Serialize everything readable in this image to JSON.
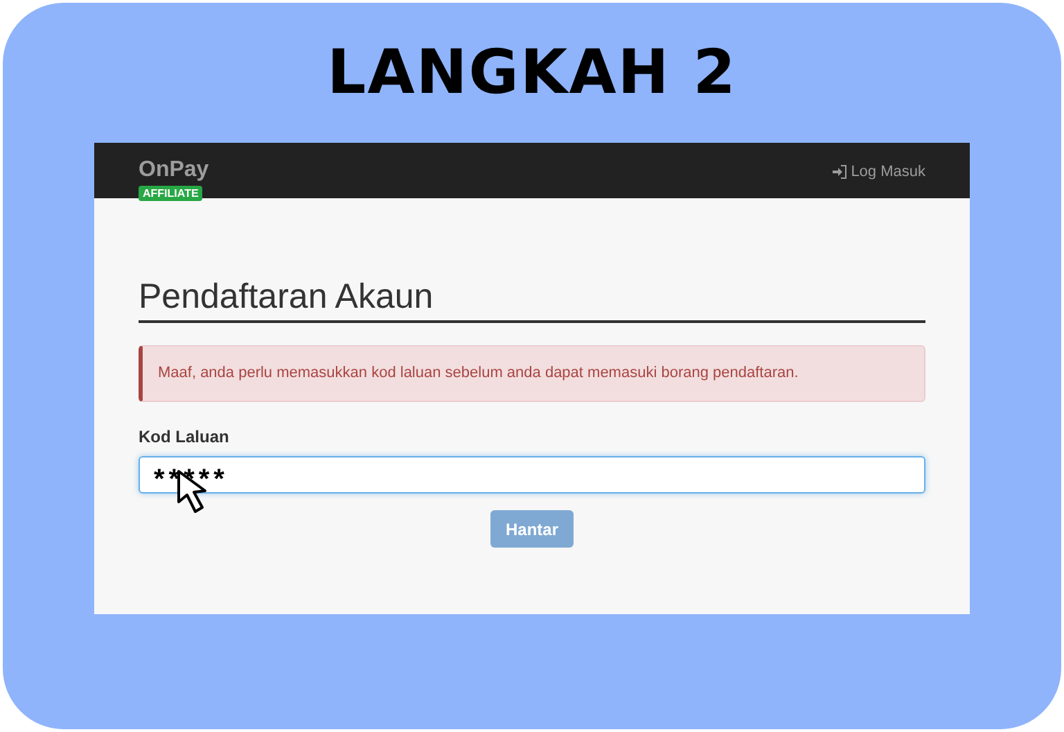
{
  "heading": "LANGKAH 2",
  "navbar": {
    "brand": "OnPay",
    "badge": "AFFILIATE",
    "login_link": "Log Masuk"
  },
  "page_title": "Pendaftaran Akaun",
  "alert": "Maaf, anda perlu memasukkan kod laluan sebelum anda dapat memasuki borang pendaftaran.",
  "field": {
    "label": "Kod Laluan",
    "value": "*****"
  },
  "submit_button": {
    "label": "Hantar",
    "disabled": true
  }
}
